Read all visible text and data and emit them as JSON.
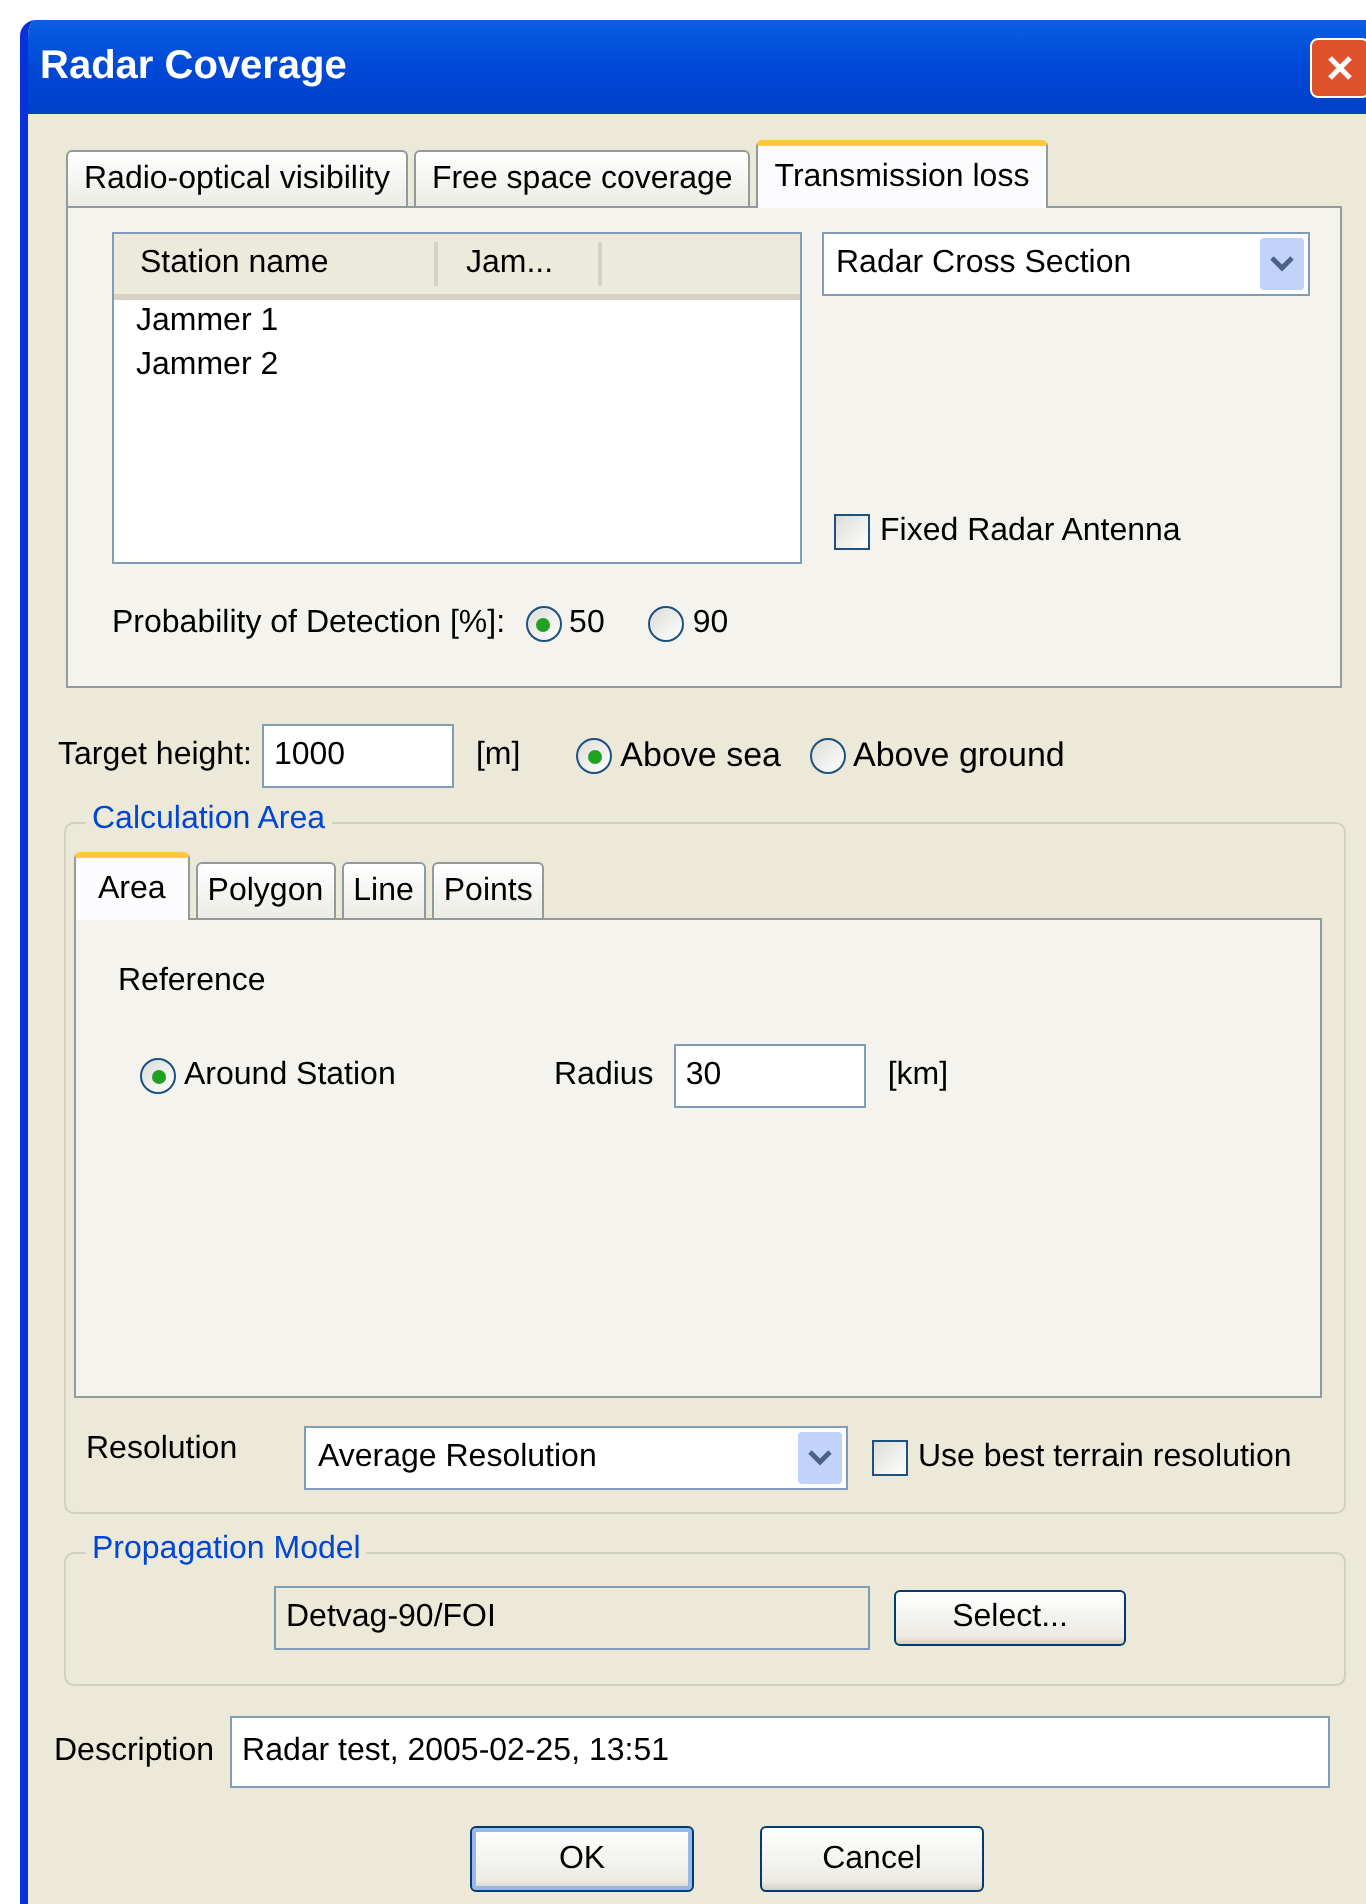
{
  "window": {
    "title": "Radar Coverage"
  },
  "tabs": [
    {
      "label": "Radio-optical visibility",
      "selected": false
    },
    {
      "label": "Free space coverage",
      "selected": false
    },
    {
      "label": "Transmission loss",
      "selected": true
    }
  ],
  "stations": {
    "columns": [
      "Station name",
      "Jam..."
    ],
    "rows": [
      "Jammer 1",
      "Jammer 2"
    ]
  },
  "cross_section": {
    "value": "Radar Cross Section"
  },
  "fixed_antenna": {
    "label": "Fixed Radar Antenna",
    "checked": false
  },
  "probability": {
    "label": "Probability of Detection [%]:",
    "options": [
      {
        "label": "50",
        "selected": true
      },
      {
        "label": "90",
        "selected": false
      }
    ]
  },
  "target_height": {
    "label": "Target height:",
    "value": "1000",
    "unit": "[m]",
    "options": [
      {
        "label": "Above sea",
        "selected": true
      },
      {
        "label": "Above ground",
        "selected": false
      }
    ]
  },
  "calculation_area": {
    "title": "Calculation Area",
    "tabs": [
      {
        "label": "Area",
        "selected": true
      },
      {
        "label": "Polygon",
        "selected": false
      },
      {
        "label": "Line",
        "selected": false
      },
      {
        "label": "Points",
        "selected": false
      }
    ],
    "reference_label": "Reference",
    "reference_options": [
      {
        "label": "Around Station",
        "selected": true
      }
    ],
    "radius": {
      "label": "Radius",
      "value": "30",
      "unit": "[km]"
    },
    "resolution": {
      "label": "Resolution",
      "value": "Average Resolution"
    },
    "best_terrain": {
      "label": "Use best terrain resolution",
      "checked": false
    }
  },
  "propagation_model": {
    "title": "Propagation Model",
    "value": "Detvag-90/FOI",
    "button": "Select..."
  },
  "description": {
    "label": "Description",
    "value": "Radar test, 2005-02-25, 13:51"
  },
  "buttons": [
    {
      "label": "OK",
      "default": true
    },
    {
      "label": "Cancel",
      "default": false
    }
  ]
}
